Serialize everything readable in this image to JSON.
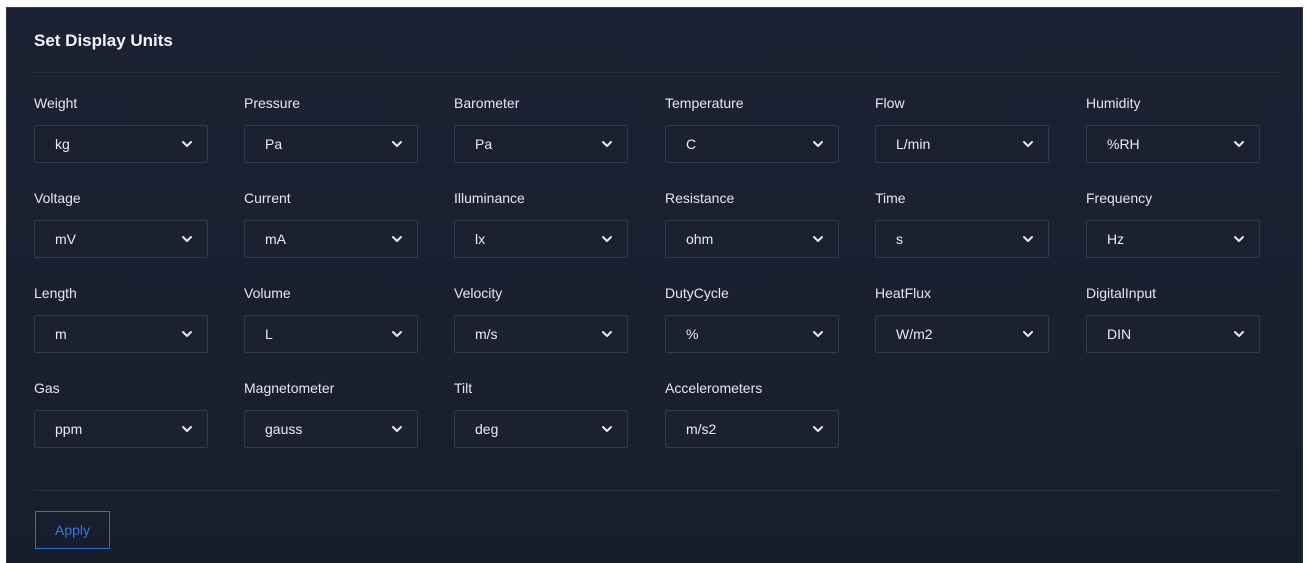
{
  "panel": {
    "title": "Set Display Units"
  },
  "fields": [
    {
      "label": "Weight",
      "value": "kg"
    },
    {
      "label": "Pressure",
      "value": "Pa"
    },
    {
      "label": "Barometer",
      "value": "Pa"
    },
    {
      "label": "Temperature",
      "value": "C"
    },
    {
      "label": "Flow",
      "value": "L/min"
    },
    {
      "label": "Humidity",
      "value": "%RH"
    },
    {
      "label": "Voltage",
      "value": "mV"
    },
    {
      "label": "Current",
      "value": "mA"
    },
    {
      "label": "Illuminance",
      "value": "lx"
    },
    {
      "label": "Resistance",
      "value": "ohm"
    },
    {
      "label": "Time",
      "value": "s"
    },
    {
      "label": "Frequency",
      "value": "Hz"
    },
    {
      "label": "Length",
      "value": "m"
    },
    {
      "label": "Volume",
      "value": "L"
    },
    {
      "label": "Velocity",
      "value": "m/s"
    },
    {
      "label": "DutyCycle",
      "value": "%"
    },
    {
      "label": "HeatFlux",
      "value": "W/m2"
    },
    {
      "label": "DigitalInput",
      "value": "DIN"
    },
    {
      "label": "Gas",
      "value": "ppm"
    },
    {
      "label": "Magnetometer",
      "value": "gauss"
    },
    {
      "label": "Tilt",
      "value": "deg"
    },
    {
      "label": "Accelerometers",
      "value": "m/s2"
    }
  ],
  "actions": {
    "apply_label": "Apply"
  },
  "colors": {
    "panel_background": "#1a2030",
    "accent": "#2f79e8"
  }
}
